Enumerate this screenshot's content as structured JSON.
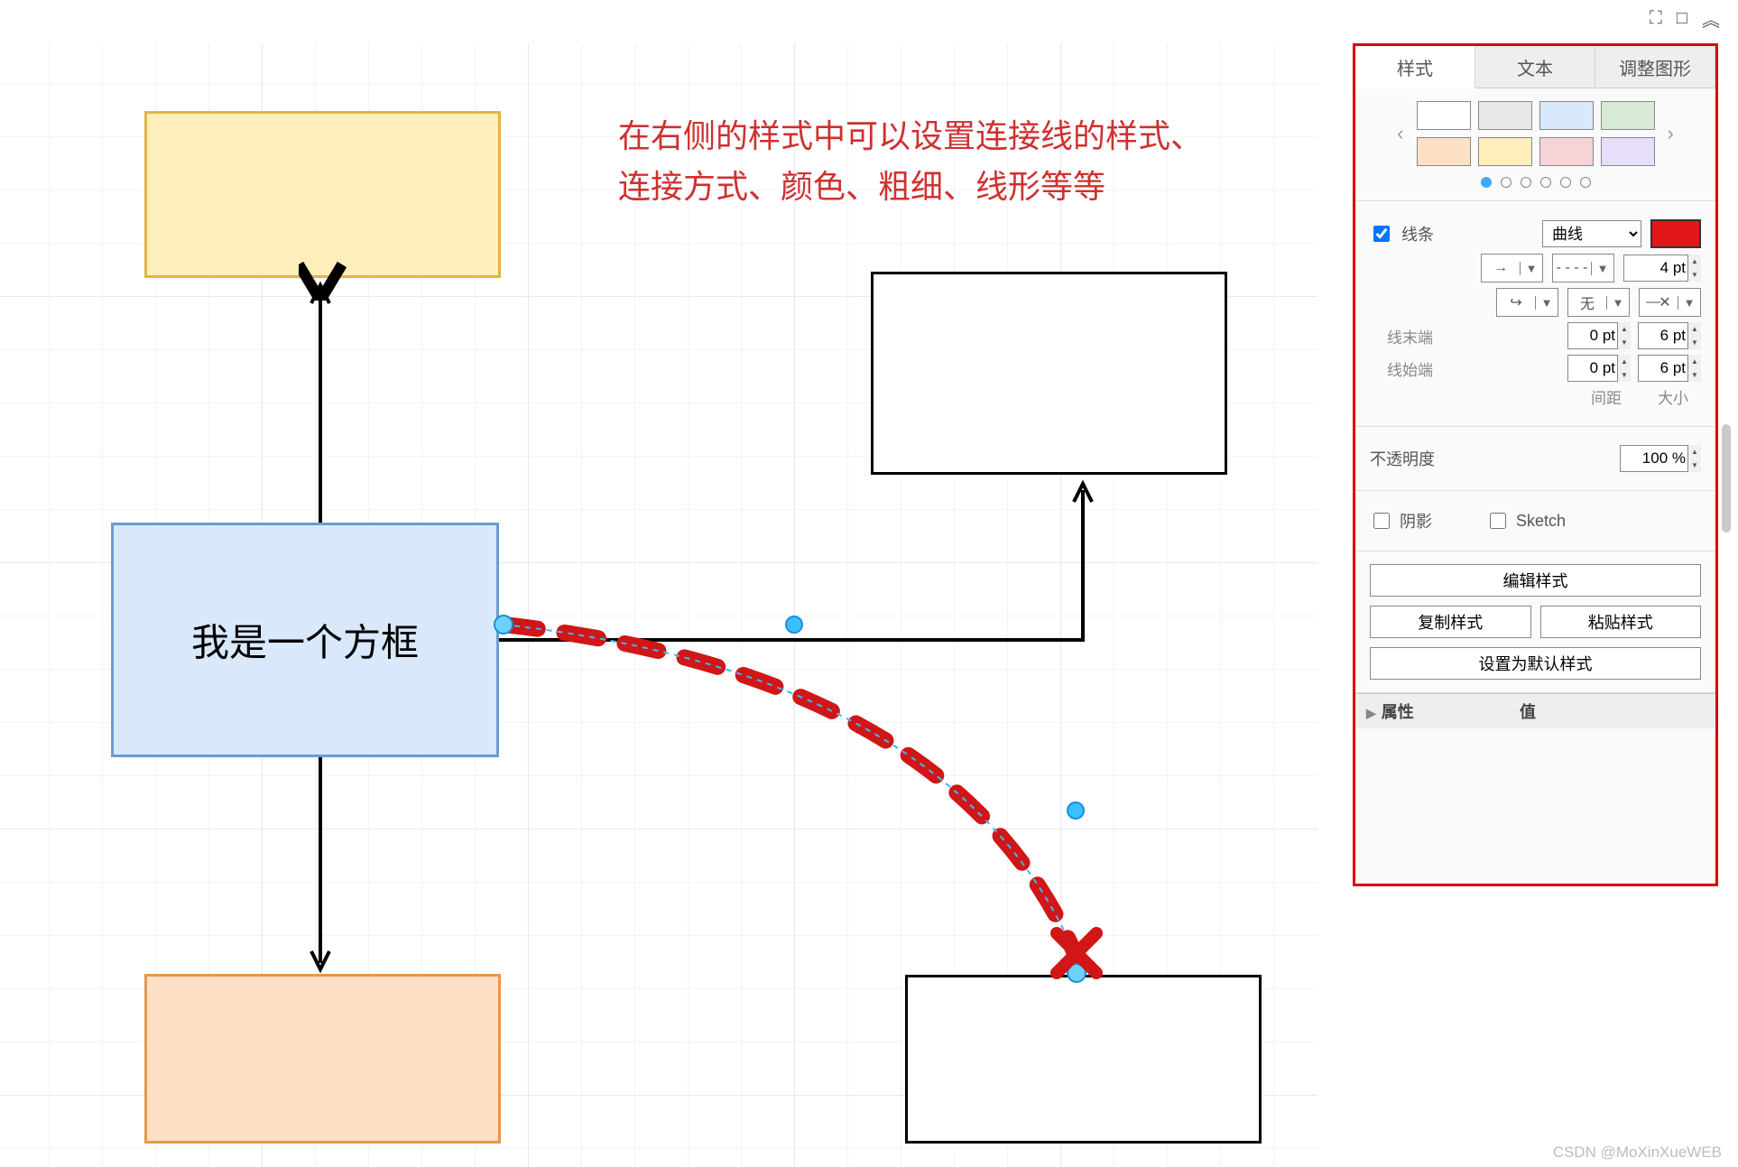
{
  "annotation": "在右侧的样式中可以设置连接线的样式、\n连接方式、颜色、粗细、线形等等",
  "shapes": {
    "blue_label": "我是一个方框"
  },
  "top_tools": {
    "fullscreen": "⛶",
    "split": "□",
    "collapse": "︽"
  },
  "panel": {
    "tabs": {
      "style": "样式",
      "text": "文本",
      "arrange": "调整图形"
    },
    "swatch_colors_top": [
      "#ffffff",
      "#e8e8e8",
      "#d9e8fb",
      "#d6ead6"
    ],
    "swatch_colors_bottom": [
      "#fde0c6",
      "#fdeebb",
      "#f6d3d6",
      "#e6defb"
    ],
    "line": {
      "checkbox_label": "线条",
      "style_selected": "曲线",
      "color": "#e21616",
      "weight_value": "4 pt",
      "arrow_icon": "→",
      "dash_icon": "- - - -",
      "curve_icon": "↪",
      "none_label": "无",
      "cross_icon": "✕"
    },
    "end": {
      "label": "线末端",
      "gap": "0 pt",
      "size": "6 pt"
    },
    "start": {
      "label": "线始端",
      "gap": "0 pt",
      "size": "6 pt"
    },
    "axis_gap": "间距",
    "axis_size": "大小",
    "opacity": {
      "label": "不透明度",
      "value": "100 %"
    },
    "shadow": "阴影",
    "sketch": "Sketch",
    "buttons": {
      "edit": "编辑样式",
      "copy": "复制样式",
      "paste": "粘贴样式",
      "default": "设置为默认样式"
    },
    "prop": {
      "attr": "属性",
      "value": "值"
    }
  },
  "watermark": "CSDN @MoXinXueWEB"
}
